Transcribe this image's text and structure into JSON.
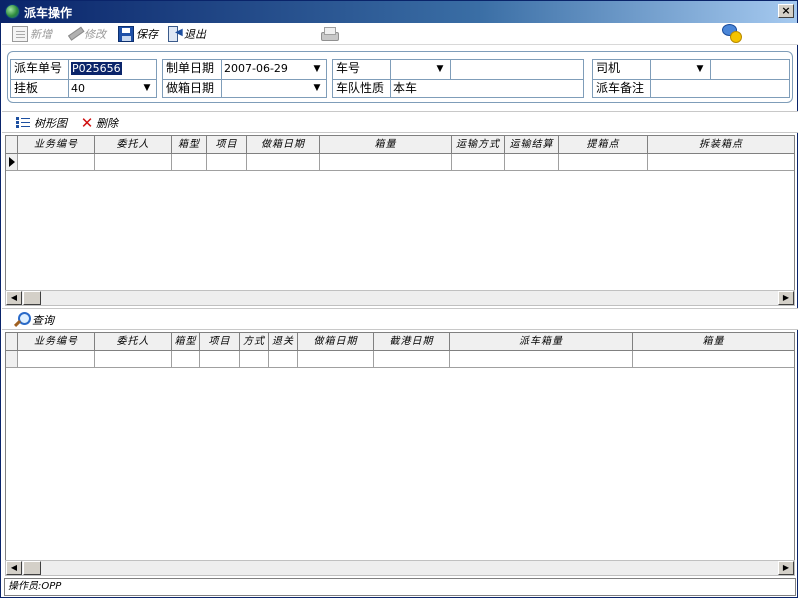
{
  "window": {
    "title": "派车操作",
    "close_label": "×"
  },
  "toolbar": {
    "new_label": "新增",
    "edit_label": "修改",
    "save_label": "保存",
    "exit_label": "退出"
  },
  "form": {
    "dispatch_no": {
      "label": "派车单号",
      "value": "P025656"
    },
    "trailer": {
      "label": "挂板",
      "value": "40"
    },
    "order_date": {
      "label": "制单日期",
      "value": "2007-06-29"
    },
    "box_date": {
      "label": "做箱日期",
      "value": ""
    },
    "truck_no": {
      "label": "车号",
      "value": ""
    },
    "fleet_type": {
      "label": "车队性质",
      "value": "本车"
    },
    "driver": {
      "label": "司机",
      "value": ""
    },
    "remark": {
      "label": "派车备注",
      "value": ""
    }
  },
  "grid1_bar": {
    "tree_label": "树形图",
    "delete_label": "删除"
  },
  "grid1": {
    "columns": [
      "业务编号",
      "委托人",
      "箱型",
      "项目",
      "做箱日期",
      "箱量",
      "运输方式",
      "运输结算",
      "提箱点",
      "拆装箱点"
    ]
  },
  "grid2_bar": {
    "query_label": "查询"
  },
  "grid2": {
    "columns": [
      "业务编号",
      "委托人",
      "箱型",
      "项目",
      "方式",
      "退关",
      "做箱日期",
      "截港日期",
      "派车箱量",
      "箱量"
    ]
  },
  "status": {
    "operator": "操作员:OPP"
  }
}
